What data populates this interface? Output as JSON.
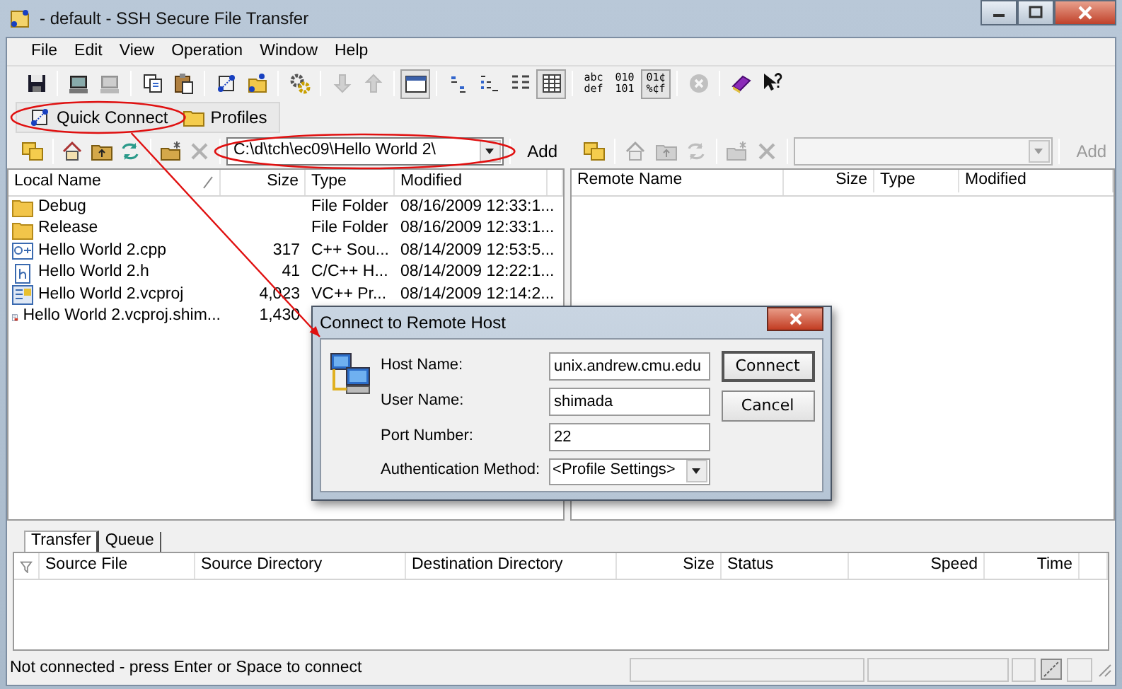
{
  "window": {
    "title": "- default - SSH Secure File Transfer"
  },
  "menu": [
    "File",
    "Edit",
    "View",
    "Operation",
    "Window",
    "Help"
  ],
  "toolbar": [
    {
      "kind": "icon",
      "disabled": false,
      "pressed": false
    },
    {
      "kind": "separator"
    },
    {
      "kind": "icon",
      "disabled": false,
      "pressed": false
    },
    {
      "kind": "icon",
      "disabled": true,
      "pressed": false
    },
    {
      "kind": "separator"
    },
    {
      "kind": "icon",
      "disabled": false,
      "pressed": false
    },
    {
      "kind": "icon",
      "disabled": false,
      "pressed": false
    },
    {
      "kind": "separator"
    },
    {
      "kind": "icon",
      "disabled": false,
      "pressed": false
    },
    {
      "kind": "icon",
      "disabled": false,
      "pressed": false
    },
    {
      "kind": "separator"
    },
    {
      "kind": "icon",
      "disabled": false,
      "pressed": false
    },
    {
      "kind": "separator"
    },
    {
      "kind": "icon",
      "disabled": true,
      "pressed": false
    },
    {
      "kind": "icon",
      "disabled": true,
      "pressed": false
    },
    {
      "kind": "separator"
    },
    {
      "kind": "icon",
      "disabled": false,
      "pressed": true
    },
    {
      "kind": "separator"
    },
    {
      "kind": "icon",
      "disabled": false,
      "pressed": false
    },
    {
      "kind": "icon",
      "disabled": false,
      "pressed": false
    },
    {
      "kind": "icon",
      "disabled": false,
      "pressed": false
    },
    {
      "kind": "icon",
      "disabled": false,
      "pressed": true
    },
    {
      "kind": "separator"
    },
    {
      "kind": "text",
      "lines": [
        "abc",
        "def"
      ],
      "disabled": false,
      "pressed": false
    },
    {
      "kind": "text",
      "lines": [
        "010",
        "101"
      ],
      "disabled": false,
      "pressed": false
    },
    {
      "kind": "text",
      "lines": [
        "01¢",
        "%¢f"
      ],
      "disabled": false,
      "pressed": true
    },
    {
      "kind": "separator"
    },
    {
      "kind": "icon",
      "disabled": true,
      "pressed": false
    },
    {
      "kind": "separator"
    },
    {
      "kind": "icon",
      "disabled": false,
      "pressed": false
    },
    {
      "kind": "icon",
      "disabled": false,
      "pressed": false
    }
  ],
  "connect_bar": [
    {
      "label": "Quick Connect",
      "circled": true
    },
    {
      "label": "Profiles",
      "circled": false
    }
  ],
  "local": {
    "toolbar": [
      {
        "kind": "icon",
        "disabled": false
      },
      {
        "kind": "separator"
      },
      {
        "kind": "icon",
        "disabled": false
      },
      {
        "kind": "icon",
        "disabled": false
      },
      {
        "kind": "icon",
        "disabled": false
      },
      {
        "kind": "separator"
      },
      {
        "kind": "icon",
        "disabled": false
      },
      {
        "kind": "icon",
        "disabled": true
      }
    ],
    "path": "C:\\d\\tch\\ec09\\Hello World 2\\",
    "path_circled": true,
    "path_disabled": false,
    "add": "Add",
    "add_disabled": false,
    "columns": [
      "Local Name",
      "Size",
      "Type",
      "Modified"
    ],
    "rows": [
      {
        "kind": "folder",
        "name": "Debug",
        "size": "",
        "type": "File Folder",
        "modified": "08/16/2009 12:33:1..."
      },
      {
        "kind": "folder",
        "name": "Release",
        "size": "",
        "type": "File Folder",
        "modified": "08/16/2009 12:33:1..."
      },
      {
        "kind": "cpp",
        "name": "Hello World 2.cpp",
        "size": "317",
        "type": "C++ Sou...",
        "modified": "08/14/2009 12:53:5..."
      },
      {
        "kind": "header",
        "name": "Hello World 2.h",
        "size": "41",
        "type": "C/C++ H...",
        "modified": "08/14/2009 12:22:1..."
      },
      {
        "kind": "project",
        "name": "Hello World 2.vcproj",
        "size": "4,023",
        "type": "VC++ Pr...",
        "modified": "08/14/2009 12:14:2..."
      },
      {
        "kind": "document",
        "name": "Hello World 2.vcproj.shim...",
        "size": "1,430",
        "type": "",
        "modified": ""
      }
    ]
  },
  "remote": {
    "toolbar": [
      {
        "kind": "icon",
        "disabled": false
      },
      {
        "kind": "separator"
      },
      {
        "kind": "icon",
        "disabled": true
      },
      {
        "kind": "icon",
        "disabled": true
      },
      {
        "kind": "icon",
        "disabled": true
      },
      {
        "kind": "separator"
      },
      {
        "kind": "icon",
        "disabled": true
      },
      {
        "kind": "icon",
        "disabled": true
      }
    ],
    "path_disabled": true,
    "add": "Add",
    "add_disabled": true,
    "columns": [
      "Remote Name",
      "Size",
      "Type",
      "Modified"
    ]
  },
  "transfer_tabs": [
    {
      "label": "Transfer",
      "selected": true
    },
    {
      "label": "Queue",
      "selected": false
    }
  ],
  "transfer_columns": [
    "Source File",
    "Source Directory",
    "Destination Directory",
    "Size",
    "Status",
    "Speed",
    "Time"
  ],
  "status_bar": {
    "message": "Not connected - press Enter or Space to connect"
  },
  "dialog": {
    "title": "Connect to Remote Host",
    "pointed_at": true,
    "fields": [
      {
        "kind": "text",
        "label": "Host Name:",
        "value": "unix.andrew.cmu.edu"
      },
      {
        "kind": "text",
        "label": "User Name:",
        "value": "shimada"
      },
      {
        "kind": "text",
        "label": "Port Number:",
        "value": "22"
      },
      {
        "kind": "select",
        "label": "Authentication Method:",
        "value": "<Profile Settings>"
      }
    ],
    "buttons": [
      {
        "label": "Connect",
        "default": true
      },
      {
        "label": "Cancel",
        "default": false
      }
    ]
  }
}
